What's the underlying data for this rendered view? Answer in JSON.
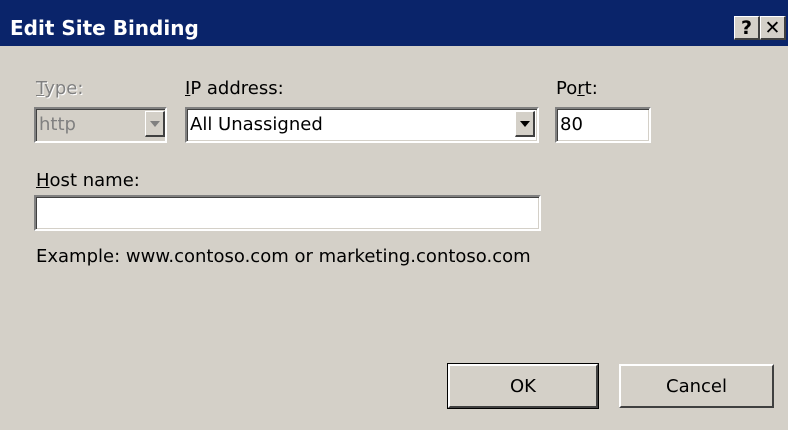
{
  "dialog": {
    "title": "Edit Site Binding",
    "help_glyph": "?",
    "close_glyph": "✕"
  },
  "type": {
    "label_mnemonic": "T",
    "label_rest": "ype:",
    "value": "http",
    "enabled": false
  },
  "ip_address": {
    "label_mnemonic": "I",
    "label_rest": "P address:",
    "value": "All Unassigned"
  },
  "port": {
    "label_prefix": "Po",
    "label_mnemonic": "r",
    "label_rest": "t:",
    "value": "80"
  },
  "host_name": {
    "label_mnemonic": "H",
    "label_rest": "ost name:",
    "value": ""
  },
  "example_text": "Example: www.contoso.com or marketing.contoso.com",
  "buttons": {
    "ok": "OK",
    "cancel": "Cancel"
  },
  "colors": {
    "title_bar": "#0a246a",
    "window_face": "#d4d0c8",
    "disabled_text": "#808080"
  }
}
